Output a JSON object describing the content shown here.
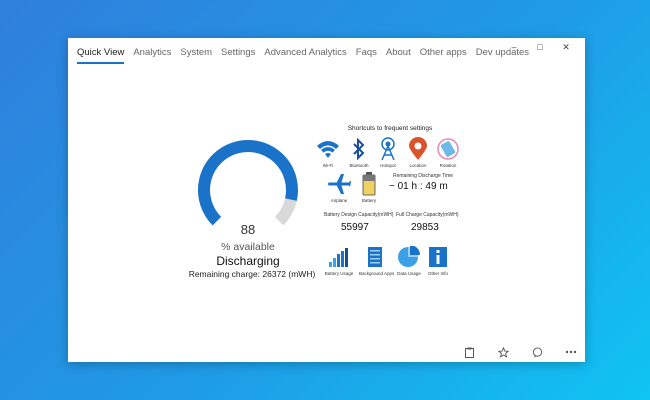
{
  "window": {
    "controls": {
      "minimize": "–",
      "maximize": "□",
      "close": "✕"
    }
  },
  "tabs": [
    {
      "label": "Quick View",
      "active": true
    },
    {
      "label": "Analytics",
      "active": false
    },
    {
      "label": "System",
      "active": false
    },
    {
      "label": "Settings",
      "active": false
    },
    {
      "label": "Advanced Analytics",
      "active": false
    },
    {
      "label": "Faqs",
      "active": false
    },
    {
      "label": "About",
      "active": false
    },
    {
      "label": "Other apps",
      "active": false
    },
    {
      "label": "Dev updates",
      "active": false
    }
  ],
  "gauge": {
    "value": "88",
    "percent": 88,
    "label": "% available",
    "status": "Discharging",
    "remaining": "Remaining charge: 26372 (mWH)",
    "color": "#1a73c9",
    "track_color": "#d9d9d9"
  },
  "shortcuts": {
    "title": "Shortcuts to frequent settings",
    "items": [
      {
        "label": "Wi-Fi",
        "icon": "wifi-icon"
      },
      {
        "label": "Bluetooth",
        "icon": "bluetooth-icon"
      },
      {
        "label": "Hotspot",
        "icon": "hotspot-icon"
      },
      {
        "label": "Location",
        "icon": "location-icon"
      },
      {
        "label": "Rotation",
        "icon": "rotation-icon"
      },
      {
        "label": "Airplane",
        "icon": "airplane-icon"
      },
      {
        "label": "Battery",
        "icon": "battery-icon"
      }
    ]
  },
  "discharge": {
    "label": "Remaining Discharge Time",
    "value": "~ 01 h : 49 m"
  },
  "design_capacity": {
    "label": "Battery Design Capacity(mWH)",
    "value": "55997"
  },
  "full_capacity": {
    "label": "Full Charge Capacity(mWH)",
    "value": "29853"
  },
  "bottom_shortcuts": [
    {
      "label": "Battery Usage",
      "icon": "battery-usage-icon"
    },
    {
      "label": "Background Apps",
      "icon": "background-apps-icon"
    },
    {
      "label": "Data Usage",
      "icon": "data-usage-icon"
    },
    {
      "label": "Other Info",
      "icon": "info-icon"
    }
  ],
  "footer_icons": [
    "clipboard-icon",
    "star-icon",
    "feedback-icon",
    "more-icon"
  ]
}
